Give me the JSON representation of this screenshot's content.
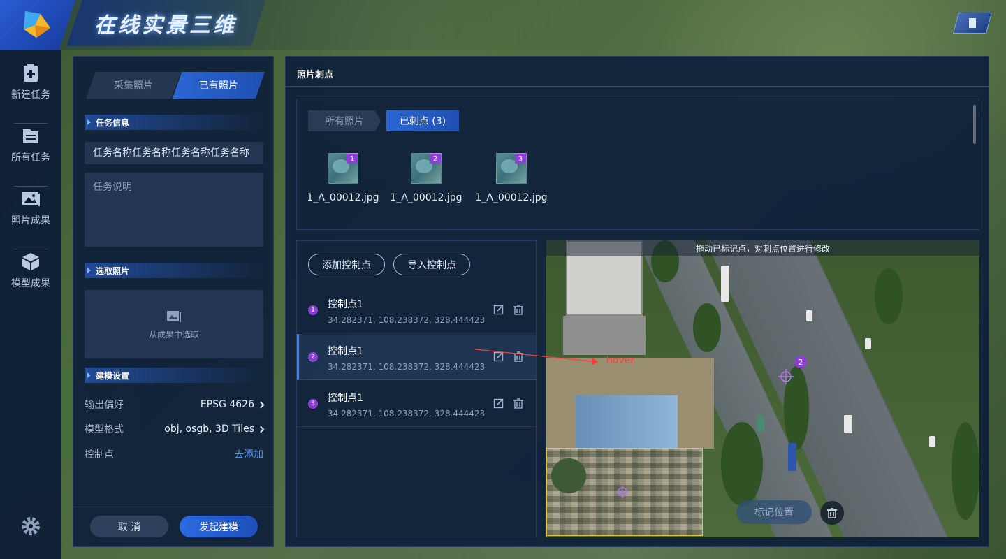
{
  "app": {
    "title": "在线实景三维"
  },
  "nav": [
    {
      "label": "新建任务",
      "icon": "clipboard-plus-icon"
    },
    {
      "label": "所有任务",
      "icon": "list-doc-icon"
    },
    {
      "label": "照片成果",
      "icon": "photo-icon"
    },
    {
      "label": "模型成果",
      "icon": "cube-icon"
    }
  ],
  "left": {
    "tabs": [
      "采集照片",
      "已有照片"
    ],
    "active_tab": "已有照片",
    "task_info_title": "任务信息",
    "task_name": "任务名称任务名称任务名称任务名称",
    "task_desc_placeholder": "任务说明",
    "select_photos_title": "选取照片",
    "pick_from_results": "从成果中选取",
    "build_settings_title": "建模设置",
    "settings": [
      {
        "label": "输出偏好",
        "value": "EPSG 4626"
      },
      {
        "label": "模型格式",
        "value": "obj, osgb, 3D Tiles"
      },
      {
        "label": "控制点",
        "value": "去添加"
      }
    ],
    "cancel": "取 消",
    "submit": "发起建模"
  },
  "right": {
    "title": "照片刺点",
    "photo_tabs": [
      "所有照片",
      "已刺点 (3)"
    ],
    "thumbs": [
      {
        "num": "1",
        "file": "1_A_00012.jpg"
      },
      {
        "num": "2",
        "file": "1_A_00012.jpg"
      },
      {
        "num": "3",
        "file": "1_A_00012.jpg"
      }
    ],
    "add_cp": "添加控制点",
    "import_cp": "导入控制点",
    "control_points": [
      {
        "num": "1",
        "name": "控制点1",
        "coords": "34.282371, 108.238372, 328.444423"
      },
      {
        "num": "2",
        "name": "控制点1",
        "coords": "34.282371, 108.238372, 328.444423"
      },
      {
        "num": "3",
        "name": "控制点1",
        "coords": "34.282371, 108.238372, 328.444423"
      }
    ],
    "map_tip": "拖动已标记点，对刺点位置进行修改",
    "mark_position": "标记位置",
    "pin_label": "2",
    "hover_note": "hover"
  },
  "colors": {
    "accent": "#2a66d4",
    "marker": "#8e3fd6",
    "inset_border": "#e3c23f"
  }
}
